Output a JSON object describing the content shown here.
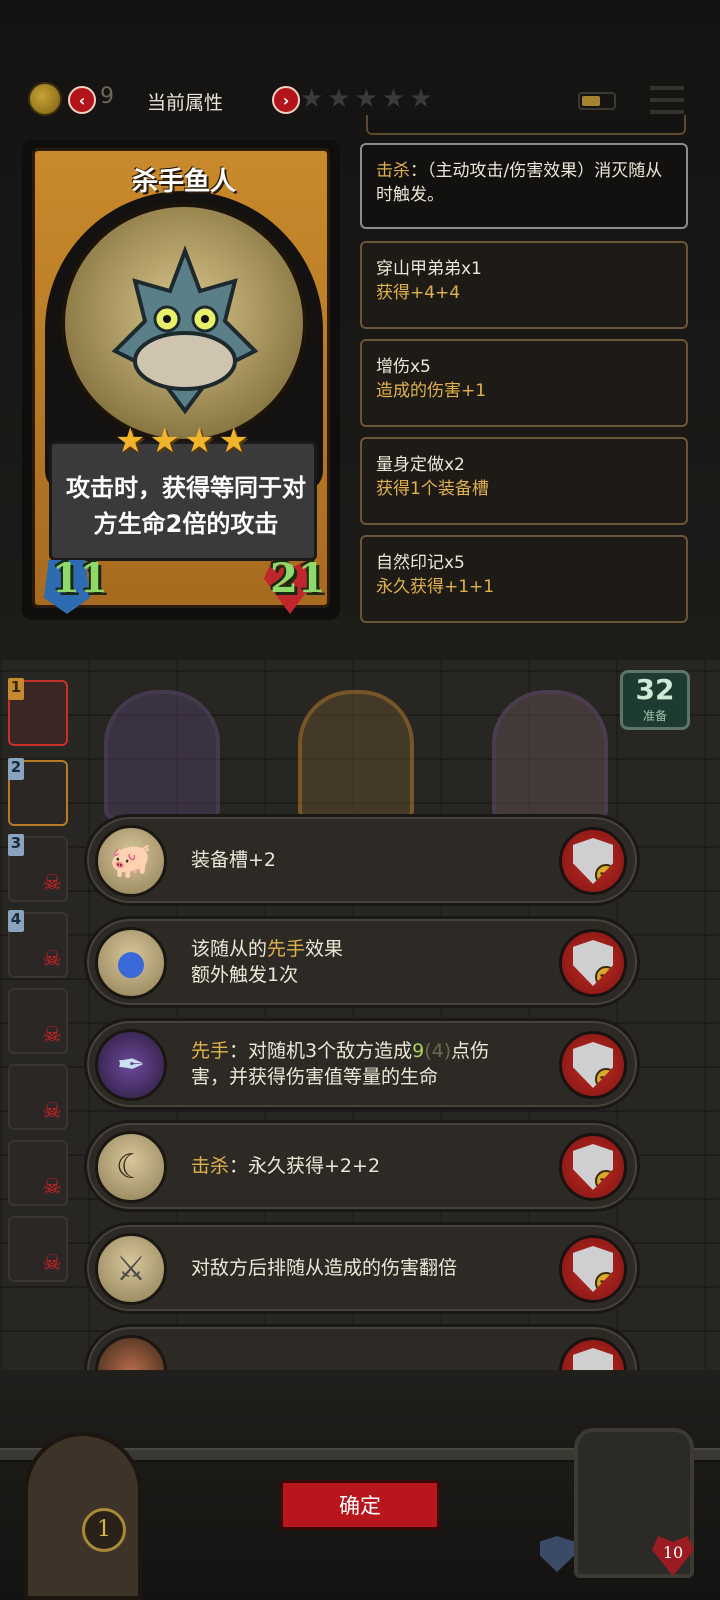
{
  "topbar": {
    "coin_value": "9",
    "title": "当前属性",
    "star_count": 5
  },
  "card": {
    "name": "杀手鱼人",
    "stars": "★★★★",
    "description": "攻击时，获得等同于对方生命2倍的攻击",
    "attack": "11",
    "health": "21"
  },
  "effects": [
    {
      "keyword": "击杀",
      "text": "：（主动攻击/伤害效果）消灭随从时触发。"
    },
    {
      "line1": "穿山甲弟弟x1",
      "line2": "获得+4+4"
    },
    {
      "line1": "增伤x5",
      "line2": "造成的伤害+1"
    },
    {
      "line1": "量身定做x2",
      "line2": "获得1个装备槽"
    },
    {
      "line1": "自然印记x5",
      "line2": "永久获得+1+1"
    }
  ],
  "board": {
    "slots": [
      "1",
      "2",
      "3",
      "4"
    ],
    "deck_count": "32",
    "deck_label": "准备"
  },
  "equipment": [
    {
      "icon": "pig-icon",
      "text": "装备槽+2"
    },
    {
      "icon": "orb-icon",
      "line1_pre": "该随从的",
      "line1_kw": "先手",
      "line1_post": "效果",
      "line2": "额外触发1次"
    },
    {
      "icon": "feather-icon",
      "kw": "先手",
      "pre": "：对随机3个敌方造成",
      "num": "9",
      "dim": "(4)",
      "post": "点伤",
      "line2": "害，并获得伤害值等量的生命"
    },
    {
      "icon": "scythe-icon",
      "kw": "击杀",
      "text": "：永久获得+2+2"
    },
    {
      "icon": "crossbow-icon",
      "text": "对敌方后排随从造成的伤害翻倍"
    }
  ],
  "confirm_label": "确定",
  "door_coin": "1",
  "hero_hp": "10",
  "colors": {
    "accent_red": "#b7161c",
    "keyword_gold": "#e0b24e",
    "stat_green": "#8fd86a"
  }
}
